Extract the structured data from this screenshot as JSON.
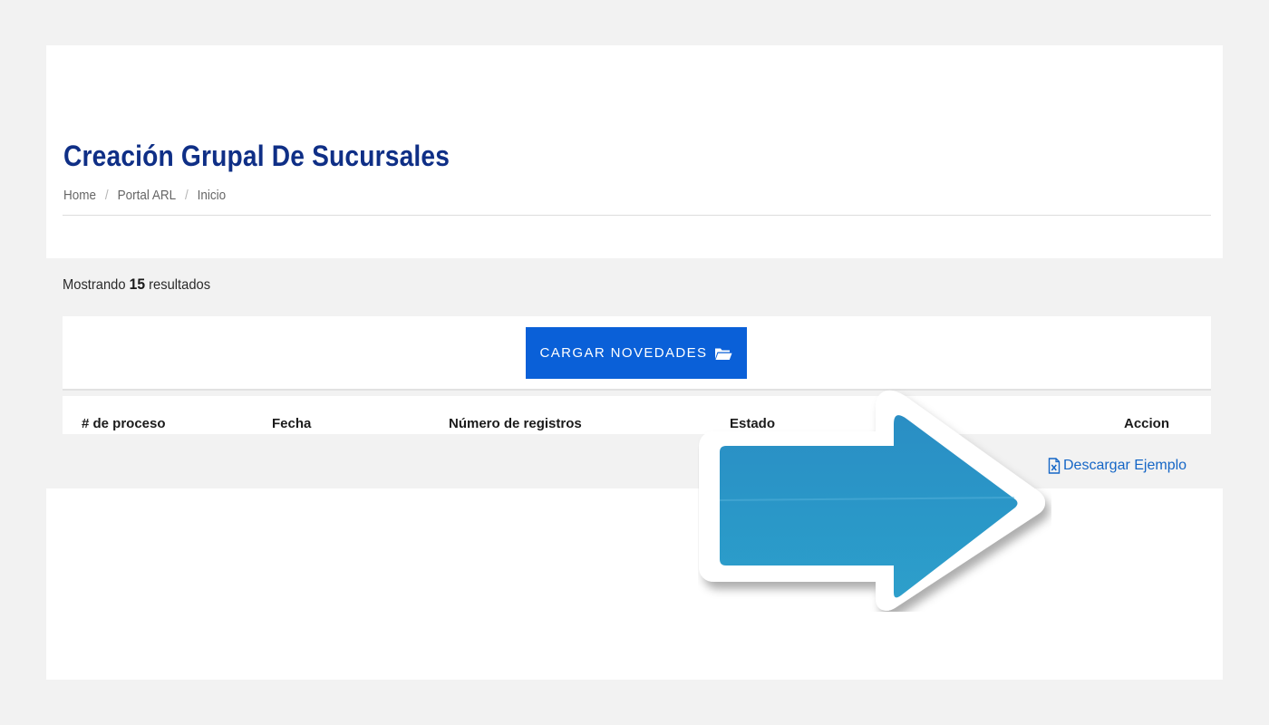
{
  "header": {
    "title": "Creación Grupal De Sucursales",
    "breadcrumb": [
      {
        "label": "Home"
      },
      {
        "label": "Portal ARL"
      },
      {
        "label": "Inicio"
      }
    ],
    "separator": "/"
  },
  "results": {
    "prefix": "Mostrando",
    "count": "15",
    "suffix": "resultados"
  },
  "upload": {
    "button_label": "CARGAR NOVEDADES",
    "icon": "folder-open-icon"
  },
  "table": {
    "columns": [
      "# de proceso",
      "Fecha",
      "Número de registros",
      "Estado",
      "Accion"
    ]
  },
  "download": {
    "label": "Descargar Ejemplo",
    "icon": "excel-file-icon"
  },
  "colors": {
    "title": "#0f2f86",
    "button": "#0a60d8",
    "link": "#1566c6",
    "arrow": "#2b95c6",
    "page_background": "#f2f2f2"
  },
  "annotation": {
    "icon": "arrow-right-icon"
  }
}
